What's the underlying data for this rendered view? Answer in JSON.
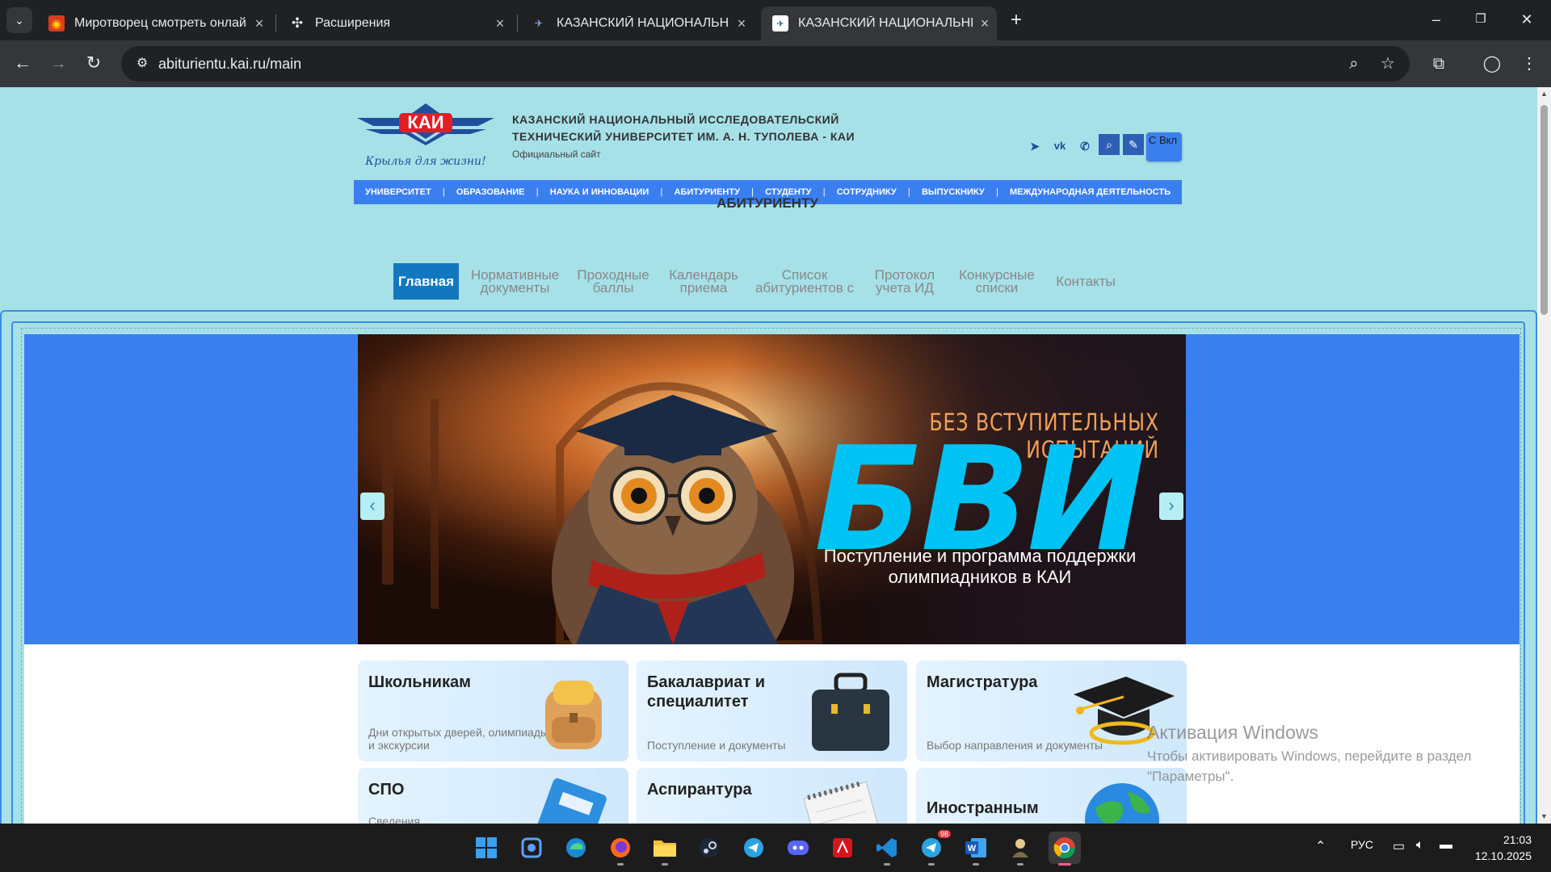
{
  "browser": {
    "tabs": [
      {
        "title": "Миротворец смотреть онлайн",
        "active": false
      },
      {
        "title": "Расширения",
        "active": false
      },
      {
        "title": "КАЗАНСКИЙ НАЦИОНАЛЬНЫЙ",
        "active": false
      },
      {
        "title": "КАЗАНСКИЙ НАЦИОНАЛЬНЫЙ",
        "active": true
      }
    ],
    "url": "abiturientu.kai.ru/main"
  },
  "header": {
    "logo_text": "КАИ",
    "logo_motto": "Крылья для жизни!",
    "uni_name": "КАЗАНСКИЙ НАЦИОНАЛЬНЫЙ ИССЛЕДОВАТЕЛЬСКИЙ ТЕХНИЧЕСКИЙ УНИВЕРСИТЕТ ИМ. А. Н. ТУПОЛЕВА - КАИ",
    "uni_sub": "Официальный сайт",
    "visually_impaired_label": "С Вкл"
  },
  "mainnav": [
    "УНИВЕРСИТЕТ",
    "ОБРАЗОВАНИЕ",
    "НАУКА И ИННОВАЦИИ",
    "АБИТУРИЕНТУ",
    "СТУДЕНТУ",
    "СОТРУДНИКУ",
    "ВЫПУСКНИКУ",
    "МЕЖДУНАРОДНАЯ ДЕЯТЕЛЬНОСТЬ"
  ],
  "section": {
    "title": "АБИТУРИЕНТУ",
    "subnav": [
      {
        "label": "Главная",
        "active": true
      },
      {
        "label": "Нормативные документы"
      },
      {
        "label": "Проходные баллы"
      },
      {
        "label": "Календарь приема"
      },
      {
        "label": "Список абитуриентов с"
      },
      {
        "label": "Протокол учета ИД"
      },
      {
        "label": "Конкурсные списки"
      },
      {
        "label": "Контакты"
      }
    ]
  },
  "slide": {
    "kicker": "БЕЗ ВСТУПИТЕЛЬНЫХ ИСПЫТАНИЙ",
    "big": "БВИ",
    "caption": "Поступление и программа поддержки олимпиадников в КАИ",
    "prev": "‹",
    "next": "›"
  },
  "cards": [
    {
      "title": "Школьникам",
      "sub": "Дни открытых дверей, олимпиады и экскурсии"
    },
    {
      "title": "Бакалавриат и специалитет",
      "sub": "Поступление и документы"
    },
    {
      "title": "Магистратура",
      "sub": "Выбор направления и документы"
    },
    {
      "title": "СПО",
      "sub": "Сведения"
    },
    {
      "title": "Аспирантура",
      "sub": ""
    },
    {
      "title": "Иностранным",
      "sub": ""
    }
  ],
  "watermark": {
    "title": "Активация Windows",
    "text": "Чтобы активировать Windows, перейдите в раздел \"Параметры\"."
  },
  "taskbar": {
    "lang": "РУС",
    "time": "21:03",
    "date": "12.10.2025",
    "telegram_badge": "98"
  },
  "colors": {
    "page_bg": "#a6e1e8",
    "nav_blue": "#3a7ff0",
    "active_tab_blue": "#1277bf",
    "bvi_cyan": "#00c3f5"
  }
}
